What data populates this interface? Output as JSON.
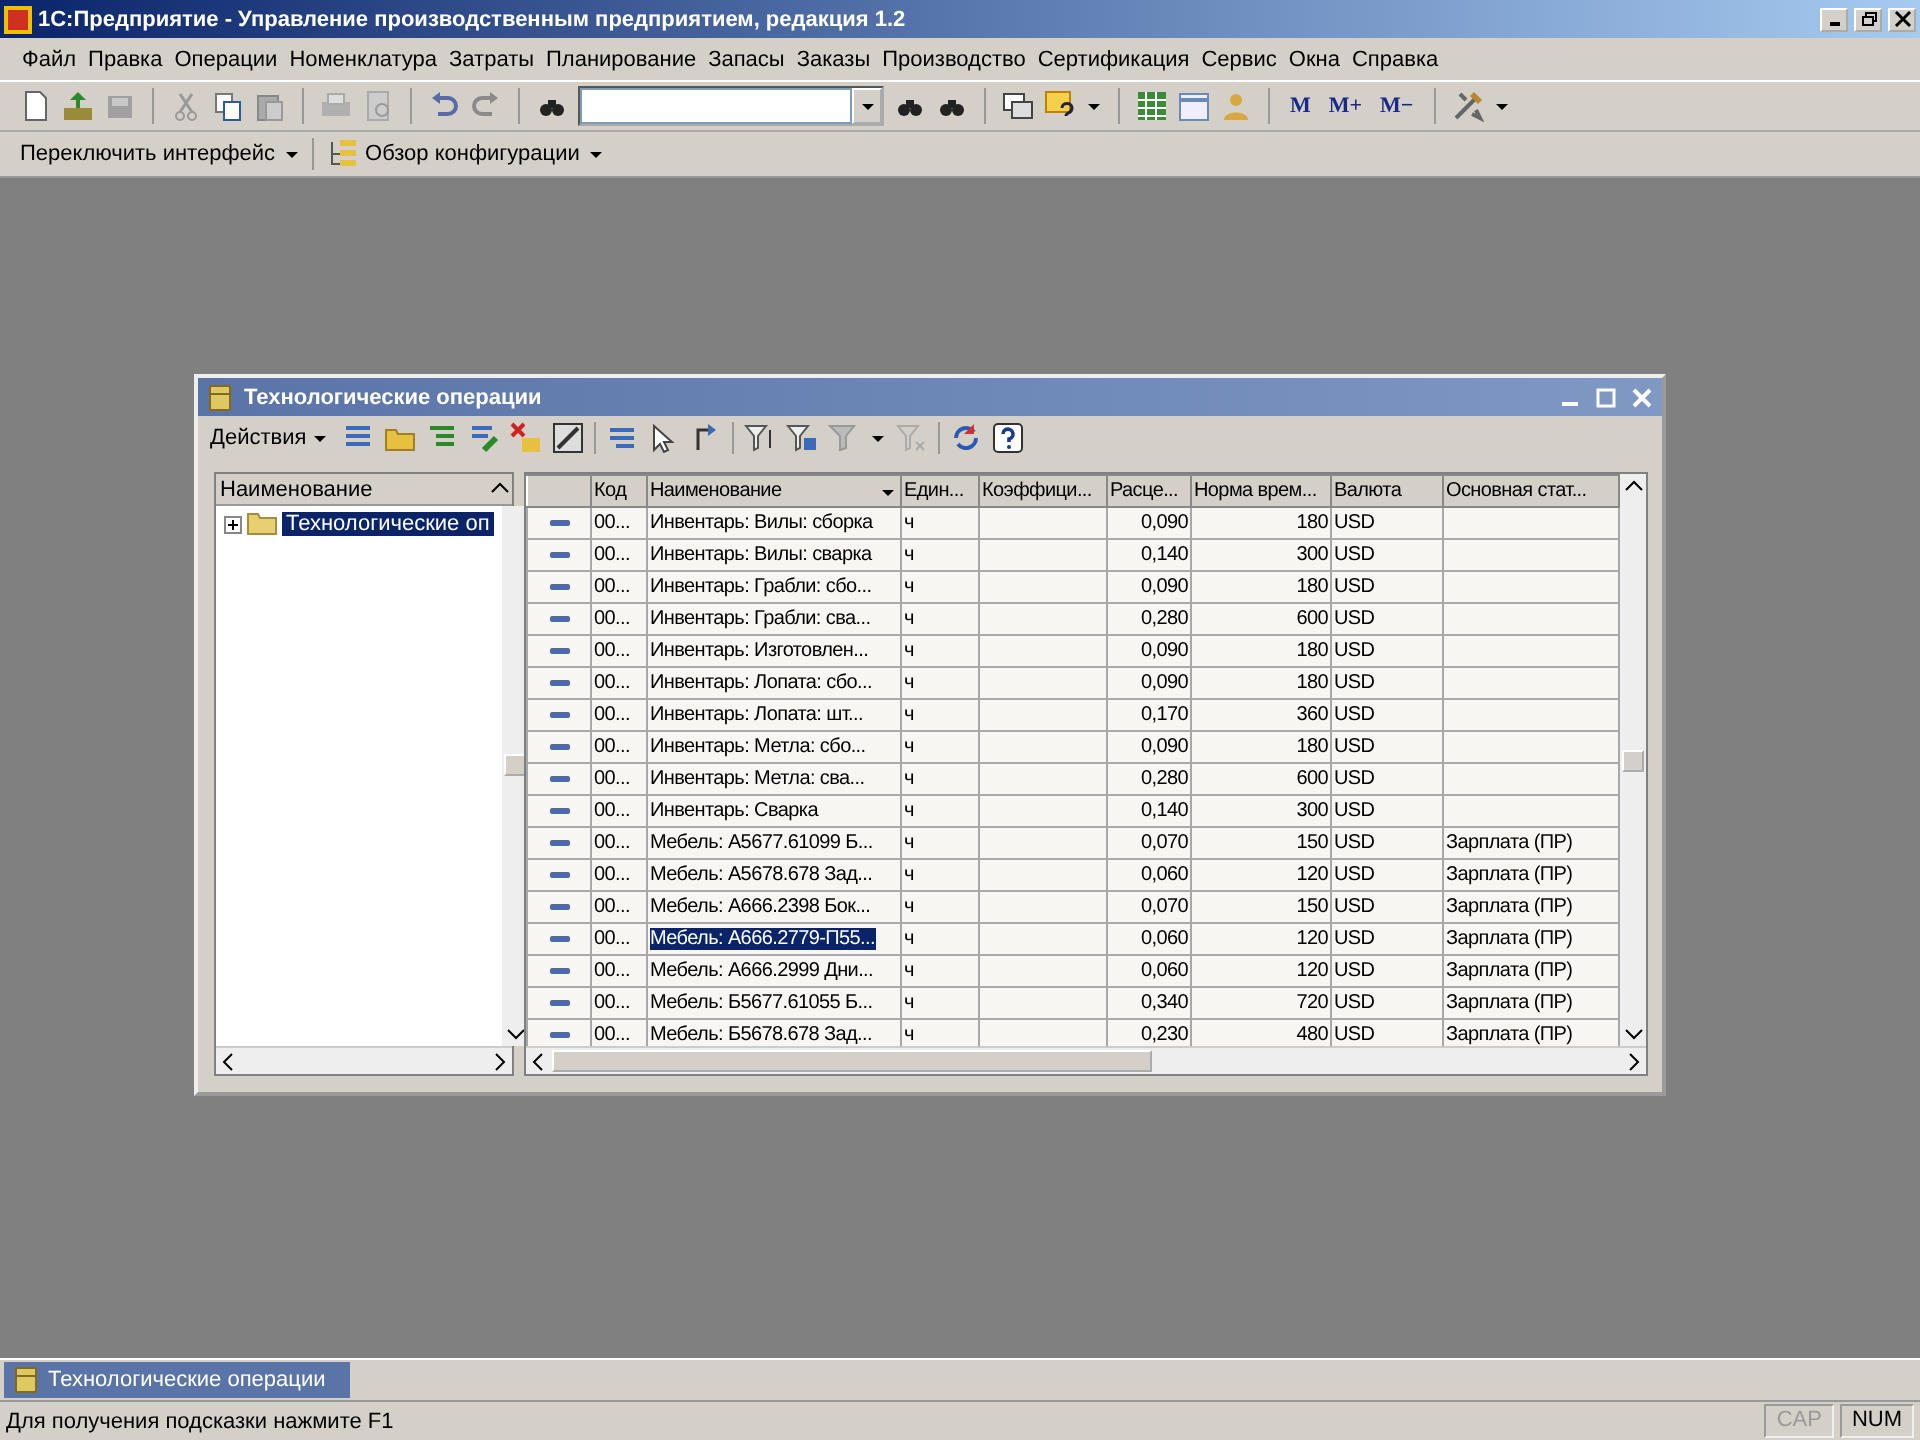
{
  "window": {
    "title": "1С:Предприятие - Управление производственным предприятием, редакция 1.2"
  },
  "menu": [
    "Файл",
    "Правка",
    "Операции",
    "Номенклатура",
    "Затраты",
    "Планирование",
    "Запасы",
    "Заказы",
    "Производство",
    "Сертификация",
    "Сервис",
    "Окна",
    "Справка"
  ],
  "toolbar": {
    "memory_buttons": [
      "M",
      "M+",
      "M−"
    ]
  },
  "toolbar2": {
    "items": [
      "Переключить интерфейс",
      "Обзор конфигурации"
    ]
  },
  "child_window": {
    "title": "Технологические операции",
    "actions_label": "Действия",
    "tree": {
      "header": "Наименование",
      "items": [
        {
          "label": "Технологические оп",
          "expanded": false,
          "selected": true
        }
      ]
    },
    "table": {
      "columns": [
        "Код",
        "Наименование",
        "Един...",
        "Коэффици...",
        "Расце...",
        "Норма врем...",
        "Валюта",
        "Основная стат..."
      ],
      "rows": [
        {
          "code": "00...",
          "name": "Инвентарь: Вилы: сборка",
          "unit": "ч",
          "rate": "0,090",
          "norm": "180",
          "currency": "USD",
          "selected": false
        },
        {
          "code": "00...",
          "name": "Инвентарь: Вилы: сварка",
          "unit": "ч",
          "rate": "0,140",
          "norm": "300",
          "currency": "USD",
          "selected": false
        },
        {
          "code": "00...",
          "name": "Инвентарь: Грабли: сбо...",
          "unit": "ч",
          "rate": "0,090",
          "norm": "180",
          "currency": "USD",
          "selected": false
        },
        {
          "code": "00...",
          "name": "Инвентарь: Грабли: сва...",
          "unit": "ч",
          "rate": "0,280",
          "norm": "600",
          "currency": "USD",
          "selected": false
        },
        {
          "code": "00...",
          "name": "Инвентарь: Изготовлен...",
          "unit": "ч",
          "rate": "0,090",
          "norm": "180",
          "currency": "USD",
          "selected": false
        },
        {
          "code": "00...",
          "name": "Инвентарь: Лопата: сбо...",
          "unit": "ч",
          "rate": "0,090",
          "norm": "180",
          "currency": "USD",
          "selected": false
        },
        {
          "code": "00...",
          "name": "Инвентарь: Лопата: шт...",
          "unit": "ч",
          "rate": "0,170",
          "norm": "360",
          "currency": "USD",
          "selected": false
        },
        {
          "code": "00...",
          "name": "Инвентарь: Метла: сбо...",
          "unit": "ч",
          "rate": "0,090",
          "norm": "180",
          "currency": "USD",
          "selected": false
        },
        {
          "code": "00...",
          "name": "Инвентарь: Метла: сва...",
          "unit": "ч",
          "rate": "0,280",
          "norm": "600",
          "currency": "USD",
          "selected": false
        },
        {
          "code": "00...",
          "name": "Инвентарь: Сварка",
          "unit": "ч",
          "rate": "0,140",
          "norm": "300",
          "currency": "USD",
          "selected": false
        },
        {
          "code": "00...",
          "name": "Мебель: А5677.61099 Б...",
          "unit": "ч",
          "rate": "0,070",
          "norm": "150",
          "currency": "USD",
          "cost_item": "Зарплата (ПР)",
          "selected": false
        },
        {
          "code": "00...",
          "name": "Мебель: А5678.678 Зад...",
          "unit": "ч",
          "rate": "0,060",
          "norm": "120",
          "currency": "USD",
          "cost_item": "Зарплата (ПР)",
          "selected": false
        },
        {
          "code": "00...",
          "name": "Мебель: А666.2398 Бок...",
          "unit": "ч",
          "rate": "0,070",
          "norm": "150",
          "currency": "USD",
          "cost_item": "Зарплата (ПР)",
          "selected": false
        },
        {
          "code": "00...",
          "name": "Мебель: А666.2779-П55...",
          "unit": "ч",
          "rate": "0,060",
          "norm": "120",
          "currency": "USD",
          "cost_item": "Зарплата (ПР)",
          "selected": true
        },
        {
          "code": "00...",
          "name": "Мебель: А666.2999 Дни...",
          "unit": "ч",
          "rate": "0,060",
          "norm": "120",
          "currency": "USD",
          "cost_item": "Зарплата (ПР)",
          "selected": false
        },
        {
          "code": "00...",
          "name": "Мебель: Б5677.61055 Б...",
          "unit": "ч",
          "rate": "0,340",
          "norm": "720",
          "currency": "USD",
          "cost_item": "Зарплата (ПР)",
          "selected": false
        },
        {
          "code": "00...",
          "name": "Мебель: Б5678.678 Зад...",
          "unit": "ч",
          "rate": "0,230",
          "norm": "480",
          "currency": "USD",
          "cost_item": "Зарплата (ПР)",
          "selected": false
        }
      ]
    }
  },
  "taskbar": [
    {
      "label": "Технологические операции",
      "selected": true
    }
  ],
  "status_bar": {
    "hint": "Для получения подсказки нажмите F1",
    "indicators": [
      {
        "label": "CAP",
        "on": false
      },
      {
        "label": "NUM",
        "on": true
      }
    ]
  }
}
